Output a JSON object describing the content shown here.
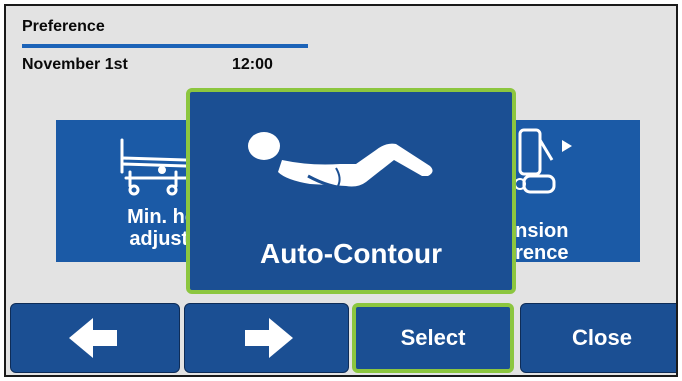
{
  "header": {
    "title": "Preference",
    "date": "November 1st",
    "time": "12:00"
  },
  "tiles": {
    "left_label_line1": "Min. he",
    "left_label_line2": "adjustr",
    "right_label_line1": "ension",
    "right_label_line2": "erence"
  },
  "featured": {
    "label": "Auto-Contour",
    "icon": "reclined-person-icon"
  },
  "buttons": {
    "left_icon": "arrow-left-icon",
    "right_icon": "arrow-right-icon",
    "select_label": "Select",
    "close_label": "Close"
  },
  "colors": {
    "accent": "#1b4f93",
    "highlight": "#8cc63f",
    "underline": "#1c63b8"
  }
}
